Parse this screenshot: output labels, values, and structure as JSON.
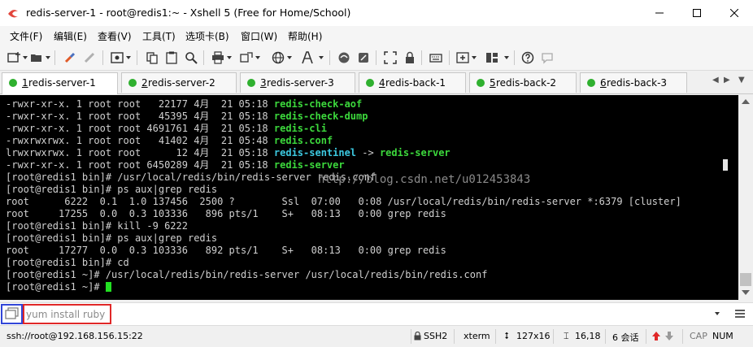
{
  "window": {
    "title": "redis-server-1 - root@redis1:~ - Xshell 5 (Free for Home/School)"
  },
  "menu": [
    "文件(F)",
    "编辑(E)",
    "查看(V)",
    "工具(T)",
    "选项卡(B)",
    "窗口(W)",
    "帮助(H)"
  ],
  "tabs": [
    {
      "num": "1",
      "label": " redis-server-1",
      "active": true
    },
    {
      "num": "2",
      "label": " redis-server-2",
      "active": false
    },
    {
      "num": "3",
      "label": " redis-server-3",
      "active": false
    },
    {
      "num": "4",
      "label": " redis-back-1",
      "active": false
    },
    {
      "num": "5",
      "label": " redis-back-2",
      "active": false
    },
    {
      "num": "6",
      "label": " redis-back-3",
      "active": false
    }
  ],
  "terminal": {
    "lines": [
      [
        {
          "t": "-rwxr-xr-x. 1 root root   22177 4月  21 05:18 "
        },
        {
          "t": "redis-check-aof",
          "s": "g"
        }
      ],
      [
        {
          "t": "-rwxr-xr-x. 1 root root   45395 4月  21 05:18 "
        },
        {
          "t": "redis-check-dump",
          "s": "g"
        }
      ],
      [
        {
          "t": "-rwxr-xr-x. 1 root root 4691761 4月  21 05:18 "
        },
        {
          "t": "redis-cli",
          "s": "g"
        }
      ],
      [
        {
          "t": "-rwxrwxrwx. 1 root root   41402 4月  21 05:48 "
        },
        {
          "t": "redis.conf",
          "s": "g"
        }
      ],
      [
        {
          "t": "lrwxrwxrwx. 1 root root      12 4月  21 05:18 "
        },
        {
          "t": "redis-sentinel",
          "s": "c"
        },
        {
          "t": " -> "
        },
        {
          "t": "redis-server",
          "s": "g"
        }
      ],
      [
        {
          "t": "-rwxr-xr-x. 1 root root 6450289 4月  21 05:18 "
        },
        {
          "t": "redis-server",
          "s": "g"
        }
      ],
      [
        {
          "t": "[root@redis1 bin]# /usr/local/redis/bin/redis-server redis.conf"
        }
      ],
      [
        {
          "t": "[root@redis1 bin]# ps aux|grep redis"
        }
      ],
      [
        {
          "t": "root      6222  0.1  1.0 137456  2500 ?        Ssl  07:00   0:08 /usr/local/redis/bin/redis-server *:6379 [cluster]"
        }
      ],
      [
        {
          "t": "root     17255  0.0  0.3 103336   896 pts/1    S+   08:13   0:00 grep redis"
        }
      ],
      [
        {
          "t": "[root@redis1 bin]# kill -9 6222"
        }
      ],
      [
        {
          "t": "[root@redis1 bin]# ps aux|grep redis"
        }
      ],
      [
        {
          "t": "root     17277  0.0  0.3 103336   892 pts/1    S+   08:13   0:00 grep redis"
        }
      ],
      [
        {
          "t": "[root@redis1 bin]# cd"
        }
      ],
      [
        {
          "t": "[root@redis1 ~]# /usr/local/redis/bin/redis-server /usr/local/redis/bin/redis.conf"
        }
      ],
      [
        {
          "t": "[root@redis1 ~]# "
        },
        {
          "t": "",
          "s": "cursor"
        }
      ]
    ],
    "watermark": "http://blog.csdn.net/u012453843"
  },
  "compose": {
    "value": "yum install ruby"
  },
  "status": {
    "connection": "ssh://root@192.168.156.15:22",
    "protocol": "SSH2",
    "terminal_type": "xterm",
    "size": "127x16",
    "cursor_pos": "16,18",
    "sessions": "6 会话",
    "cap": "CAP",
    "num": "NUM"
  },
  "colors": {
    "terminal_bg": "#000000",
    "terminal_fg": "#d0d0d0",
    "file_green": "#3cd83c",
    "link_cyan": "#3cc8e0",
    "tab_dot": "#2fb02f",
    "compose_highlight_blue": "#3246d8",
    "compose_highlight_red": "#e02828"
  },
  "icons": [
    "xshell-logo-icon",
    "minimize-icon",
    "maximize-icon",
    "close-icon",
    "new-session-icon",
    "open-folder-icon",
    "reconnect-icon",
    "disconnect-icon",
    "properties-icon",
    "copy-icon",
    "paste-icon",
    "find-icon",
    "print-icon",
    "transfer-icon",
    "globe-icon",
    "font-icon",
    "xftp-icon",
    "script-icon",
    "fullscreen-icon",
    "lock-icon",
    "keyboard-icon",
    "add-tab-icon",
    "layout-icon",
    "help-icon",
    "chat-icon",
    "compose-toggle-icon",
    "menu-icon",
    "arrow-up-icon",
    "arrow-down-icon"
  ]
}
